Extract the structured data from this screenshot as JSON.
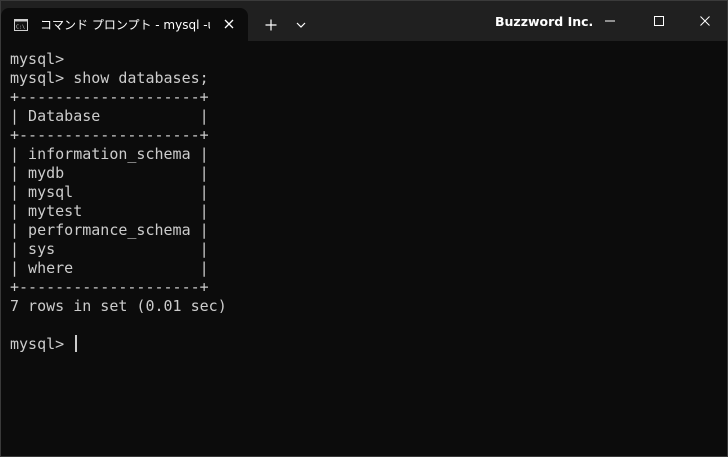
{
  "tab": {
    "title": "コマンド プロンプト - mysql  -u roo",
    "icon": "command-prompt-icon",
    "close_icon": "close-icon"
  },
  "titlebar": {
    "app_title": "Buzzword Inc.",
    "new_tab_icon": "plus-icon",
    "dropdown_icon": "chevron-down-icon",
    "minimize_icon": "minimize-icon",
    "maximize_icon": "maximize-icon",
    "close_icon": "close-icon"
  },
  "console": {
    "lines": [
      "mysql>",
      "mysql> show databases;",
      "+--------------------+",
      "| Database           |",
      "+--------------------+",
      "| information_schema |",
      "| mydb               |",
      "| mysql              |",
      "| mytest             |",
      "| performance_schema |",
      "| sys                |",
      "| where              |",
      "+--------------------+",
      "7 rows in set (0.01 sec)",
      "",
      "mysql> "
    ]
  },
  "colors": {
    "background": "#0c0c0c",
    "titlebar": "#202020",
    "text": "#cccccc"
  }
}
